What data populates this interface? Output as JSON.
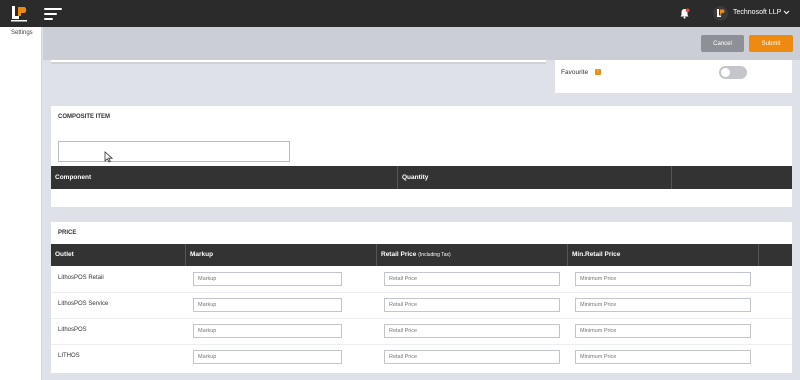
{
  "header": {
    "company_name": "Technosoft LLP"
  },
  "sidebar": {
    "settings_label": "Settings"
  },
  "toolbar": {
    "cancel_label": "Cancel",
    "submit_label": "Submit"
  },
  "favourite": {
    "label": "Favourite",
    "info_icon": "!",
    "enabled": false
  },
  "composite": {
    "title": "COMPOSITE ITEM",
    "search_value": "",
    "columns": [
      "Component",
      "Quantity",
      ""
    ]
  },
  "price": {
    "title": "PRICE",
    "columns": {
      "outlet": "Outlet",
      "markup": "Markup",
      "retail": "Retail Price",
      "retail_note": "(Including Tax)",
      "min_retail": "Min.Retail Price"
    },
    "placeholders": {
      "markup": "Markup",
      "retail": "Retail Price",
      "min_retail": "Minimum Price"
    },
    "rows": [
      {
        "outlet": "LithosPOS Retail"
      },
      {
        "outlet": "LithosPOS Service"
      },
      {
        "outlet": "LithosPOS"
      },
      {
        "outlet": "LITHOS"
      }
    ]
  },
  "colors": {
    "accent": "#ee8a0f",
    "header_bg": "#2b2b2b",
    "table_head": "#333333"
  }
}
